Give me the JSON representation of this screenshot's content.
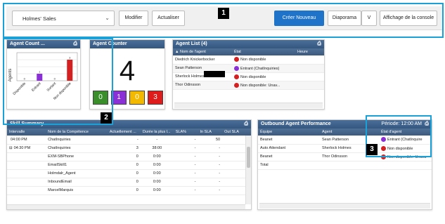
{
  "toolbar": {
    "queue_select": "Holmes' Sales",
    "modify": "Modifier",
    "update": "Actualiser",
    "create_new": "Créer Nouveau",
    "slideshow": "Diaporama",
    "slideshow_toggle": "V",
    "console_view": "Affichage de la console",
    "primary_color": "#1f73c8"
  },
  "callouts": [
    "1",
    "2",
    "3"
  ],
  "agent_count": {
    "title": "Agent Count ...",
    "y_axis_label": "Agents",
    "chart_data": {
      "type": "bar",
      "categories": [
        "Disponible",
        "Entrant",
        "Sortant",
        "Non disponible"
      ],
      "values": [
        0,
        1,
        0,
        3
      ],
      "colors": [
        "#2e8b2e",
        "#8b2fd6",
        "#e0a800",
        "#d42020"
      ],
      "ylim": [
        0,
        4
      ],
      "grid": true
    }
  },
  "agent_counter": {
    "title": "Agent Counter",
    "total": "4",
    "boxes": [
      {
        "value": "0",
        "color": "#3a8f2b"
      },
      {
        "value": "1",
        "color": "#8b2fd6"
      },
      {
        "value": "0",
        "color": "#f3b800"
      },
      {
        "value": "3",
        "color": "#e01b1b"
      }
    ]
  },
  "agent_list": {
    "title": "Agent List (4)",
    "columns": [
      "Nom de l'agent",
      "État",
      "Heure"
    ],
    "rows": [
      {
        "name": "Diedrich Knickerbocker",
        "state": "Non disponible",
        "color": "#d42020"
      },
      {
        "name": "Sean Patterson",
        "state": "Entrant (ChatInquiries)",
        "color": "#8b2fd6"
      },
      {
        "name": "Sherlock Holmes",
        "state": "Non disponible",
        "color": "#d42020"
      },
      {
        "name": "Thor Odinsson",
        "state": "Non disponible: Unav...",
        "color": "#d42020"
      }
    ]
  },
  "skill_summary": {
    "title": "Skill Summary",
    "columns": [
      "Intervalle",
      "Nom de la Compétence",
      "Actuellement ...",
      "Durée la plus l...",
      "SLA%",
      "In SLA",
      "Out SLA"
    ],
    "rows": [
      [
        "04:00 PM",
        "ChatInquiries",
        "-",
        "-",
        "-",
        "50",
        "-"
      ],
      [
        "04:30 PM",
        "ChatInquiries",
        "3",
        "38:00",
        "-",
        "-",
        "-"
      ],
      [
        "",
        "EXM-SBPhone",
        "0",
        "0:00",
        "-",
        "-",
        "-"
      ],
      [
        "",
        "EmailSkill1",
        "0",
        "0:00",
        "-",
        "-",
        "-"
      ],
      [
        "",
        "Holmdalr_Agent",
        "0",
        "0:00",
        "-",
        "-",
        "-"
      ],
      [
        "",
        "InboundEmail",
        "0",
        "0:00",
        "-",
        "-",
        "-"
      ],
      [
        "",
        "MarcelMarquis",
        "0",
        "0:00",
        "-",
        "-",
        "-"
      ]
    ],
    "expand_symbol": "⊟"
  },
  "outbound": {
    "title": "Outbound Agent Performance",
    "period": "Période: 12:00 AM",
    "columns": [
      "Équipe",
      "Agent",
      "État d'agent"
    ],
    "rows": [
      {
        "team": "Beanet",
        "agent": "Sean Patterson",
        "state": "Entrant (ChatInquire",
        "color": "#8b2fd6"
      },
      {
        "team": "Auto Attendant",
        "agent": "Sherlock Holmes",
        "state": "Non disponible",
        "color": "#d42020"
      },
      {
        "team": "Beanet",
        "agent": "Thor Odinsson",
        "state": "Non disponible: Unava",
        "color": "#d42020"
      },
      {
        "team": "Total",
        "agent": "",
        "state": "",
        "color": ""
      }
    ]
  }
}
